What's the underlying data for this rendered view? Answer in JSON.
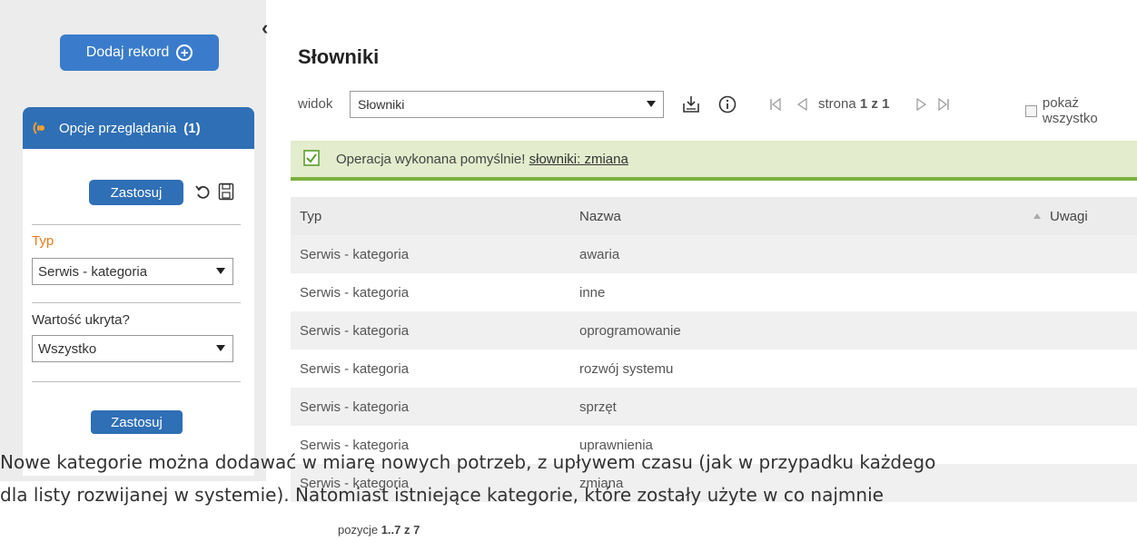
{
  "sidebar": {
    "add_record_label": "Dodaj rekord",
    "panel_title": "Opcje przeglądania",
    "panel_count": "(1)",
    "apply_label": "Zastosuj",
    "filters": [
      {
        "label": "Typ",
        "value": "Serwis - kategoria"
      },
      {
        "label": "Wartość ukryta?",
        "value": "Wszystko"
      }
    ],
    "apply_bottom_label": "Zastosuj"
  },
  "main": {
    "title": "Słowniki",
    "view_label": "widok",
    "view_value": "Słowniki",
    "pager": {
      "prefix": "strona",
      "current": "1",
      "of": "z",
      "total": "1"
    },
    "show_all_label": "pokaż wszystko",
    "alert": {
      "message": "Operacja wykonana pomyślnie!",
      "link": "słowniki: zmiana"
    },
    "columns": [
      "Typ",
      "Nazwa",
      "Uwagi"
    ],
    "rows": [
      [
        "Serwis - kategoria",
        "awaria"
      ],
      [
        "Serwis - kategoria",
        "inne"
      ],
      [
        "Serwis - kategoria",
        "oprogramowanie"
      ],
      [
        "Serwis - kategoria",
        "rozwój systemu"
      ],
      [
        "Serwis - kategoria",
        "sprzęt"
      ],
      [
        "Serwis - kategoria",
        "uprawnienia"
      ],
      [
        "Serwis - kategoria",
        "zmiana"
      ]
    ],
    "footer": {
      "prefix": "pozycje",
      "range": "1..7 z 7"
    }
  },
  "caption": {
    "line1": "Nowe kategorie można dodawać w miarę nowych potrzeb, z upływem czasu (jak w przypadku każdego",
    "line2": "dla listy rozwijanej w systemie). Natomiast istniejące kategorie, które zostały użyte w co najmnie"
  },
  "colors": {
    "accent": "#2f6fb5",
    "success_bg": "#e3eccd",
    "success_border": "#79b23e",
    "label_orange": "#e87b1c"
  }
}
